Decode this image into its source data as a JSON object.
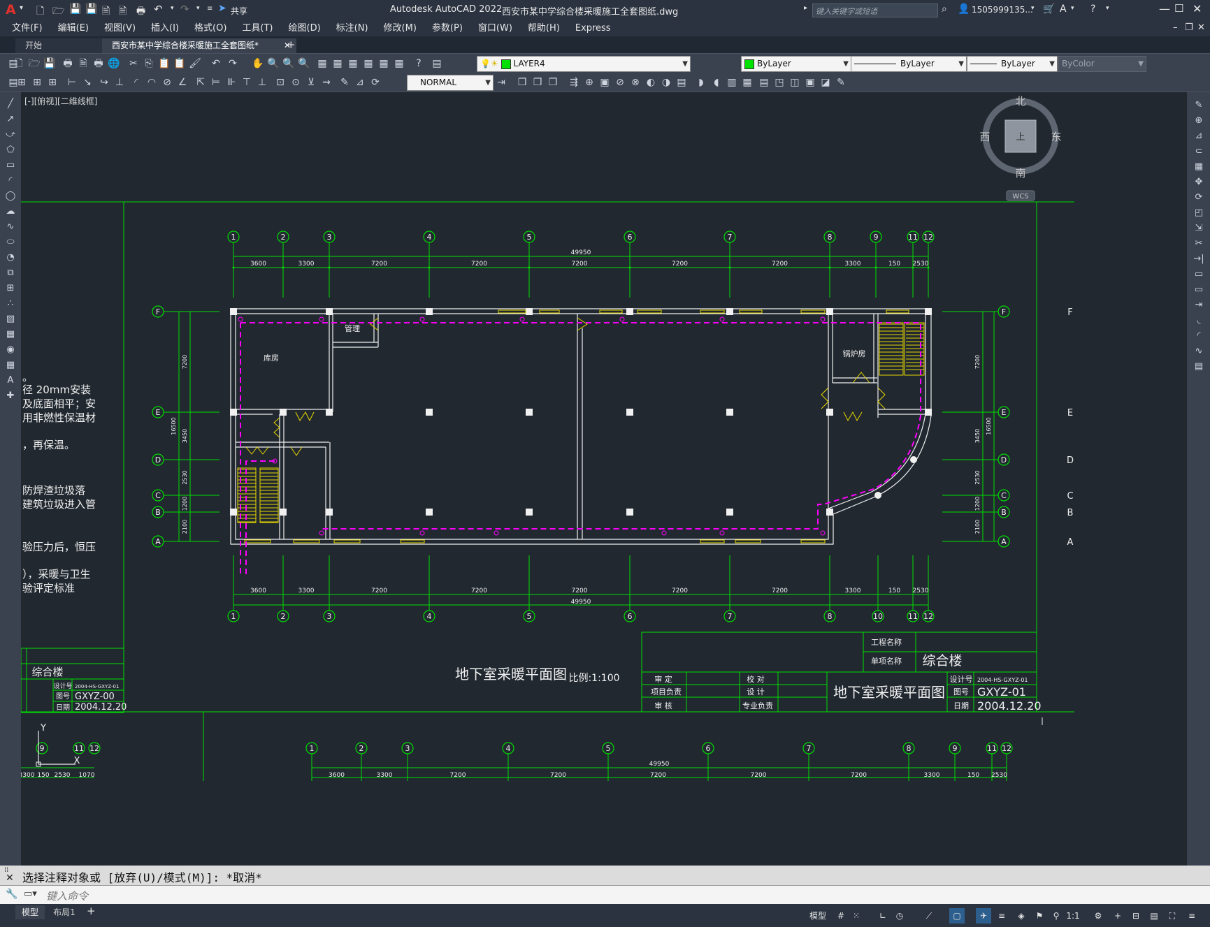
{
  "app": {
    "title": "Autodesk AutoCAD 2022",
    "filename": "西安市某中学综合楼采暖施工全套图纸.dwg",
    "share_label": "共享",
    "search_placeholder": "键入关键字或短语",
    "user": "1505999135...",
    "logo": "A"
  },
  "menus": [
    "文件(F)",
    "编辑(E)",
    "视图(V)",
    "插入(I)",
    "格式(O)",
    "工具(T)",
    "绘图(D)",
    "标注(N)",
    "修改(M)",
    "参数(P)",
    "窗口(W)",
    "帮助(H)",
    "Express"
  ],
  "tabs": [
    {
      "label": "开始"
    },
    {
      "label": "西安市某中学综合楼采暖施工全套图纸*"
    }
  ],
  "toolbar": {
    "layer": "LAYER4",
    "color": "ByLayer",
    "linetype": "ByLayer",
    "lineweight": "ByLayer",
    "plotstyle": "ByColor",
    "textstyle": "NORMAL"
  },
  "viewport": {
    "label": "[-][俯视][二维线框]"
  },
  "viewcube": {
    "north": "北",
    "south": "南",
    "east": "东",
    "west": "西",
    "face": "上",
    "wcs": "WCS"
  },
  "drawing": {
    "notes": [
      "。",
      "径 20mm安装",
      "及底面相平；安",
      "用非燃性保温材",
      "，再保温。",
      "防焊渣垃圾落",
      "建筑垃圾进入管",
      "验压力后，恒压",
      "），采暖与卫生",
      "验评定标准"
    ],
    "left_block": {
      "name": "综合楼",
      "design_no_label": "设计号",
      "design_no": "2004-HS-GXYZ-01",
      "drawing_no_label": "图号",
      "drawing_no": "GXYZ-00",
      "date_label": "日期",
      "date": "2004.12.20"
    },
    "plan_title": "地下室采暖平面图",
    "scale": "比例:1:100",
    "rooms": [
      "库房",
      "管理",
      "锅炉房"
    ],
    "axes_top": [
      "1",
      "2",
      "3",
      "4",
      "5",
      "6",
      "7",
      "8",
      "9",
      "11",
      "12"
    ],
    "axes_bottom": [
      "1",
      "2",
      "3",
      "4",
      "5",
      "6",
      "7",
      "8",
      "10",
      "11",
      "12"
    ],
    "axes_rows": [
      "F",
      "E",
      "D",
      "C",
      "B",
      "A"
    ],
    "dims_horizontal": [
      "3600",
      "3300",
      "7200",
      "7200",
      "7200",
      "7200",
      "7200",
      "3300",
      "150",
      "2530",
      "1070"
    ],
    "dim_total": "49950",
    "dims_vertical": [
      "7200",
      "3450",
      "2530",
      "1200",
      "2100"
    ],
    "dim_vertical_total": "16500",
    "bottom_axes": [
      "1",
      "2",
      "3",
      "4",
      "5",
      "6",
      "7",
      "8",
      "9",
      "11",
      "12"
    ],
    "bottom_left_axes": [
      "9",
      "11",
      "12"
    ],
    "bottom_left_dims": [
      "3300",
      "150",
      "2530",
      "1070"
    ],
    "titleblock": {
      "project_name_label": "工程名称",
      "item_name_label": "单项名称",
      "item_name": "综合楼",
      "approve": "审 定",
      "project_lead": "项目负责",
      "review": "审 核",
      "check": "校 对",
      "design": "设 计",
      "specialty_lead": "专业负责",
      "title": "地下室采暖平面图",
      "design_no_label": "设计号",
      "design_no": "2004-HS-GXYZ-01",
      "drawing_no_label": "图号",
      "drawing_no": "GXYZ-01",
      "date_label": "日期",
      "date": "2004.12.20"
    },
    "ucs": {
      "x": "X",
      "y": "Y"
    }
  },
  "command": {
    "history": "选择注释对象或 [放弃(U)/模式(M)]: *取消*",
    "placeholder": "键入命令"
  },
  "status": {
    "tabs": [
      "模型",
      "布局1"
    ],
    "model": "模型",
    "scale": "1:1"
  },
  "colors": {
    "green": "#00e000",
    "magenta": "#ff00ff",
    "yellow": "#e8d800",
    "white": "#f0f0f0",
    "bg": "#212830"
  }
}
